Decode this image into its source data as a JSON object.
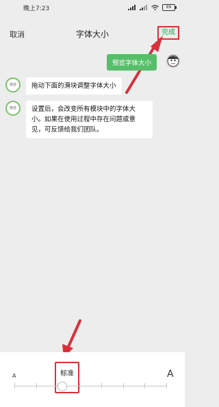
{
  "status_bar": {
    "time": "晚上7:23",
    "battery": "99"
  },
  "nav": {
    "cancel": "取消",
    "title": "字体大小",
    "done": "完成"
  },
  "chat": {
    "preview_bubble": "预览字体大小",
    "bot_avatar_text": "我自",
    "bot_message_1": "拖动下面的滑块调整字体大小",
    "bot_message_2": "设置后，会改变所有模块中的字体大小。如果在使用过程中存在问题或意见，可反馈给我们团队。"
  },
  "font_size": {
    "small_label": "A",
    "large_label": "A",
    "current_label": "标准",
    "level": 1,
    "levels": 8
  },
  "colors": {
    "accent_green": "#12b44a",
    "bubble_green": "#57be6a",
    "annotation_red": "#d9303a"
  }
}
